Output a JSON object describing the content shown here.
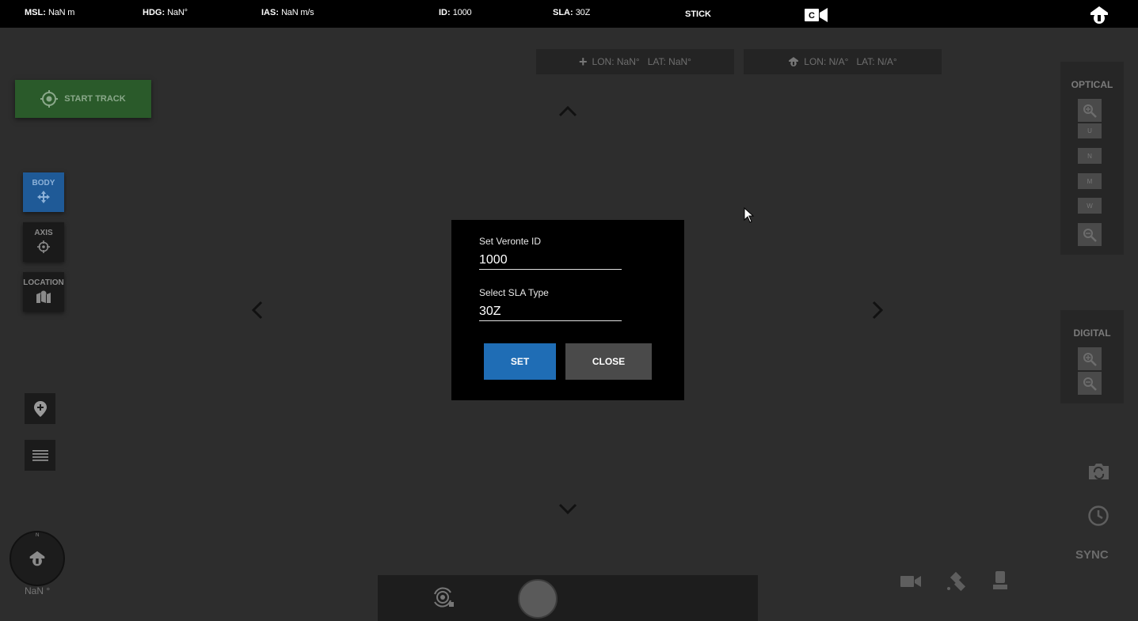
{
  "topbar": {
    "msl_label": "MSL:",
    "msl_value": "NaN  m",
    "hdg_label": "HDG:",
    "hdg_value": "NaN°",
    "ias_label": "IAS:",
    "ias_value": "NaN  m/s",
    "id_label": "ID:",
    "id_value": "1000",
    "sla_label": "SLA:",
    "sla_value": "30Z",
    "mode": "STICK",
    "camera_toggle_letter": "C"
  },
  "coords": {
    "target": "LON: NaN°   LAT: NaN°",
    "home": "LON: N/A°   LAT: N/A°"
  },
  "start_track": "START TRACK",
  "modes": [
    {
      "label": "BODY"
    },
    {
      "label": "AXIS"
    },
    {
      "label": "LOCATION"
    }
  ],
  "compass": {
    "north": "N",
    "value": "NaN °"
  },
  "optical": {
    "title": "OPTICAL",
    "buttons": [
      "U",
      "N",
      "M",
      "W"
    ]
  },
  "digital": {
    "title": "DIGITAL"
  },
  "sync_label": "SYNC",
  "modal": {
    "id_label": "Set Veronte ID",
    "id_value": "1000",
    "sla_label": "Select SLA Type",
    "sla_value": "30Z",
    "set_label": "SET",
    "close_label": "CLOSE"
  },
  "colors": {
    "accent": "#1f6db5",
    "track_green": "#2a5a2a",
    "close_gray": "#4a4a4a"
  }
}
